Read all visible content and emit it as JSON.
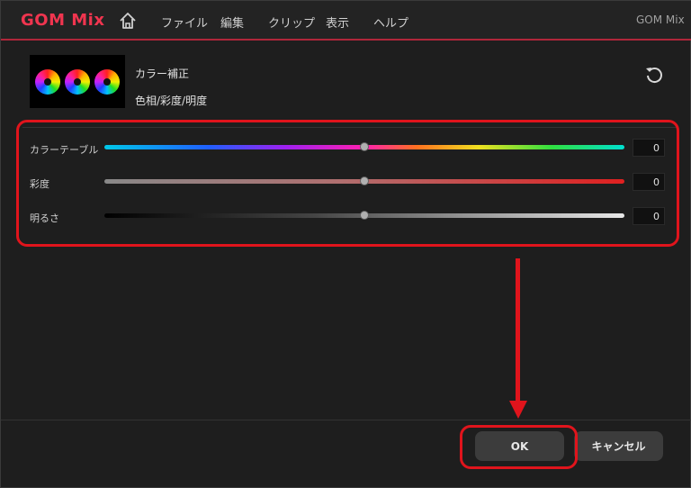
{
  "menubar": {
    "logo": "GOM Mix",
    "items": [
      "ファイル",
      "編集",
      "クリップ",
      "表示",
      "ヘルプ"
    ],
    "app_title": "GOM Mix"
  },
  "effect": {
    "name": "カラー補正",
    "subtitle": "色相/彩度/明度"
  },
  "sliders": [
    {
      "label": "カラーテーブル",
      "value": "0",
      "level": 0.5
    },
    {
      "label": "彩度",
      "value": "0",
      "level": 0.5
    },
    {
      "label": "明るさ",
      "value": "0",
      "level": 0.5
    }
  ],
  "footer": {
    "ok_label": "OK",
    "cancel_label": "キャンセル"
  },
  "colors": {
    "accent": "#e0141c",
    "brand": "#f0354f"
  },
  "icons": {
    "home": "home-icon",
    "reset": "reset-icon"
  }
}
